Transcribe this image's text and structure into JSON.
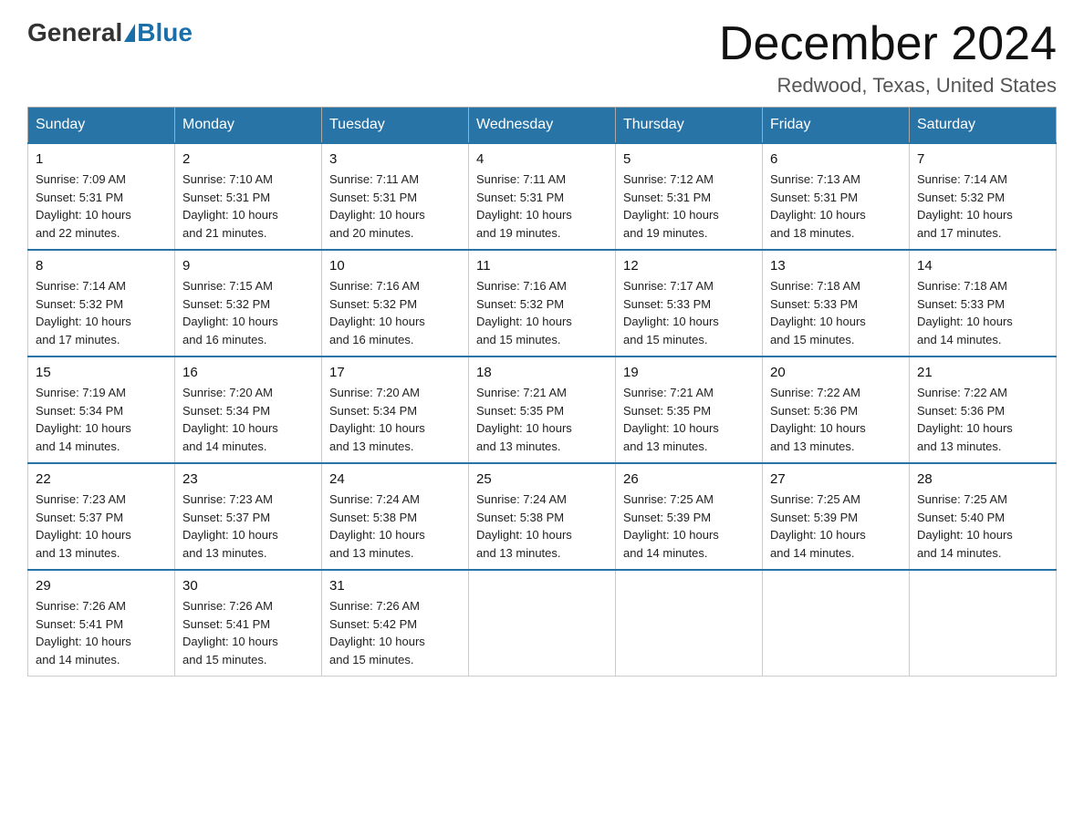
{
  "logo": {
    "general": "General",
    "blue": "Blue"
  },
  "title": {
    "month_year": "December 2024",
    "location": "Redwood, Texas, United States"
  },
  "days_of_week": [
    "Sunday",
    "Monday",
    "Tuesday",
    "Wednesday",
    "Thursday",
    "Friday",
    "Saturday"
  ],
  "weeks": [
    [
      {
        "day": "1",
        "sunrise": "7:09 AM",
        "sunset": "5:31 PM",
        "daylight": "10 hours and 22 minutes."
      },
      {
        "day": "2",
        "sunrise": "7:10 AM",
        "sunset": "5:31 PM",
        "daylight": "10 hours and 21 minutes."
      },
      {
        "day": "3",
        "sunrise": "7:11 AM",
        "sunset": "5:31 PM",
        "daylight": "10 hours and 20 minutes."
      },
      {
        "day": "4",
        "sunrise": "7:11 AM",
        "sunset": "5:31 PM",
        "daylight": "10 hours and 19 minutes."
      },
      {
        "day": "5",
        "sunrise": "7:12 AM",
        "sunset": "5:31 PM",
        "daylight": "10 hours and 19 minutes."
      },
      {
        "day": "6",
        "sunrise": "7:13 AM",
        "sunset": "5:31 PM",
        "daylight": "10 hours and 18 minutes."
      },
      {
        "day": "7",
        "sunrise": "7:14 AM",
        "sunset": "5:32 PM",
        "daylight": "10 hours and 17 minutes."
      }
    ],
    [
      {
        "day": "8",
        "sunrise": "7:14 AM",
        "sunset": "5:32 PM",
        "daylight": "10 hours and 17 minutes."
      },
      {
        "day": "9",
        "sunrise": "7:15 AM",
        "sunset": "5:32 PM",
        "daylight": "10 hours and 16 minutes."
      },
      {
        "day": "10",
        "sunrise": "7:16 AM",
        "sunset": "5:32 PM",
        "daylight": "10 hours and 16 minutes."
      },
      {
        "day": "11",
        "sunrise": "7:16 AM",
        "sunset": "5:32 PM",
        "daylight": "10 hours and 15 minutes."
      },
      {
        "day": "12",
        "sunrise": "7:17 AM",
        "sunset": "5:33 PM",
        "daylight": "10 hours and 15 minutes."
      },
      {
        "day": "13",
        "sunrise": "7:18 AM",
        "sunset": "5:33 PM",
        "daylight": "10 hours and 15 minutes."
      },
      {
        "day": "14",
        "sunrise": "7:18 AM",
        "sunset": "5:33 PM",
        "daylight": "10 hours and 14 minutes."
      }
    ],
    [
      {
        "day": "15",
        "sunrise": "7:19 AM",
        "sunset": "5:34 PM",
        "daylight": "10 hours and 14 minutes."
      },
      {
        "day": "16",
        "sunrise": "7:20 AM",
        "sunset": "5:34 PM",
        "daylight": "10 hours and 14 minutes."
      },
      {
        "day": "17",
        "sunrise": "7:20 AM",
        "sunset": "5:34 PM",
        "daylight": "10 hours and 13 minutes."
      },
      {
        "day": "18",
        "sunrise": "7:21 AM",
        "sunset": "5:35 PM",
        "daylight": "10 hours and 13 minutes."
      },
      {
        "day": "19",
        "sunrise": "7:21 AM",
        "sunset": "5:35 PM",
        "daylight": "10 hours and 13 minutes."
      },
      {
        "day": "20",
        "sunrise": "7:22 AM",
        "sunset": "5:36 PM",
        "daylight": "10 hours and 13 minutes."
      },
      {
        "day": "21",
        "sunrise": "7:22 AM",
        "sunset": "5:36 PM",
        "daylight": "10 hours and 13 minutes."
      }
    ],
    [
      {
        "day": "22",
        "sunrise": "7:23 AM",
        "sunset": "5:37 PM",
        "daylight": "10 hours and 13 minutes."
      },
      {
        "day": "23",
        "sunrise": "7:23 AM",
        "sunset": "5:37 PM",
        "daylight": "10 hours and 13 minutes."
      },
      {
        "day": "24",
        "sunrise": "7:24 AM",
        "sunset": "5:38 PM",
        "daylight": "10 hours and 13 minutes."
      },
      {
        "day": "25",
        "sunrise": "7:24 AM",
        "sunset": "5:38 PM",
        "daylight": "10 hours and 13 minutes."
      },
      {
        "day": "26",
        "sunrise": "7:25 AM",
        "sunset": "5:39 PM",
        "daylight": "10 hours and 14 minutes."
      },
      {
        "day": "27",
        "sunrise": "7:25 AM",
        "sunset": "5:39 PM",
        "daylight": "10 hours and 14 minutes."
      },
      {
        "day": "28",
        "sunrise": "7:25 AM",
        "sunset": "5:40 PM",
        "daylight": "10 hours and 14 minutes."
      }
    ],
    [
      {
        "day": "29",
        "sunrise": "7:26 AM",
        "sunset": "5:41 PM",
        "daylight": "10 hours and 14 minutes."
      },
      {
        "day": "30",
        "sunrise": "7:26 AM",
        "sunset": "5:41 PM",
        "daylight": "10 hours and 15 minutes."
      },
      {
        "day": "31",
        "sunrise": "7:26 AM",
        "sunset": "5:42 PM",
        "daylight": "10 hours and 15 minutes."
      },
      null,
      null,
      null,
      null
    ]
  ],
  "labels": {
    "sunrise": "Sunrise:",
    "sunset": "Sunset:",
    "daylight": "Daylight: 10 hours"
  }
}
